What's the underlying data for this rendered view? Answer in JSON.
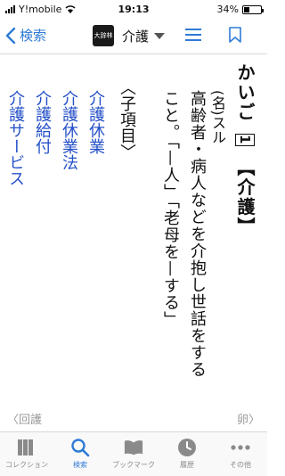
{
  "status": {
    "carrier": "Y!mobile",
    "time": "19:13",
    "battery": "34%",
    "battery_level": 0.34
  },
  "nav": {
    "back_label": "検索",
    "dict_logo": "大辞林",
    "dict_title": "介護",
    "accent": "#2f7bd6"
  },
  "entry": {
    "headword": "かいご",
    "sense_num": "1",
    "kanji": "【介護】",
    "pos": "(名)スル",
    "definition_line1": "高齢者・病人などを介抱し世話をする",
    "definition_line2": "こと。「—人」「老母を—する」",
    "subitems_title": "〈子項目〉",
    "subitems": [
      "介護休業",
      "介護休業法",
      "介護給付",
      "介護サービス"
    ],
    "link_color": "#2450c8"
  },
  "pager": {
    "prev": "〈回護",
    "next": "卵〉"
  },
  "tabs": [
    {
      "label": "コレクション",
      "icon": "books-icon"
    },
    {
      "label": "検索",
      "icon": "search-icon"
    },
    {
      "label": "ブックマーク",
      "icon": "bookmark-book-icon"
    },
    {
      "label": "履歴",
      "icon": "history-clock-icon"
    },
    {
      "label": "その他",
      "icon": "more-dots-icon"
    }
  ]
}
